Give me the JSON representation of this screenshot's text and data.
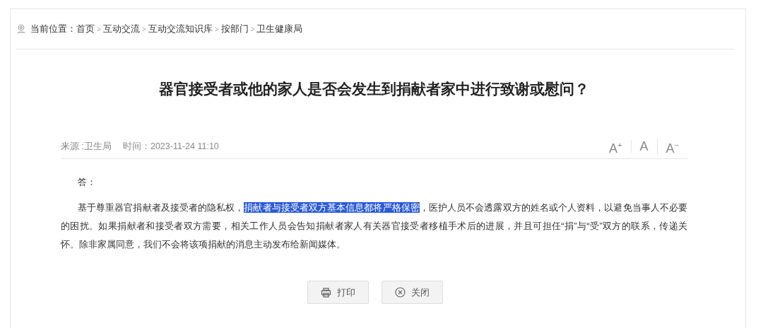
{
  "breadcrumb": {
    "label": "当前位置：",
    "items": [
      "首页",
      "互动交流",
      "互动交流知识库",
      "按部门",
      "卫生健康局"
    ],
    "separator": ">"
  },
  "article": {
    "title": "器官接受者或他的家人是否会发生到捐献者家中进行致谢或慰问？",
    "source": "来源 :卫生局",
    "time": "时间：2023-11-24 11:10",
    "font_controls": [
      "A$^{+}$",
      "A",
      "A$^{−}$"
    ],
    "answer_label": "答：",
    "paragraph": [
      {
        "text": "基于尊重器官捐献者及接受者的隐私权，",
        "selected": false
      },
      {
        "text": "捐献者与接受者双方基本信息都将严格保密",
        "selected": true
      },
      {
        "text": "，医护人员不会透露双方的姓名或个人资料，以避免当事人不必要的困扰。如果捐献者和接受者双方需要，相关工作人员会告知捐献者家人有关器官接受者移植手术后的进展，并且可担任“捐”与“受”双方的联系，传递关怀。除非家属同意，我们不会将该项捐献的消息主动发布给新闻媒体。",
        "selected": false
      }
    ]
  },
  "buttons": [
    {
      "kind": "print",
      "label": "打印"
    },
    {
      "kind": "close",
      "label": "关闭"
    }
  ]
}
